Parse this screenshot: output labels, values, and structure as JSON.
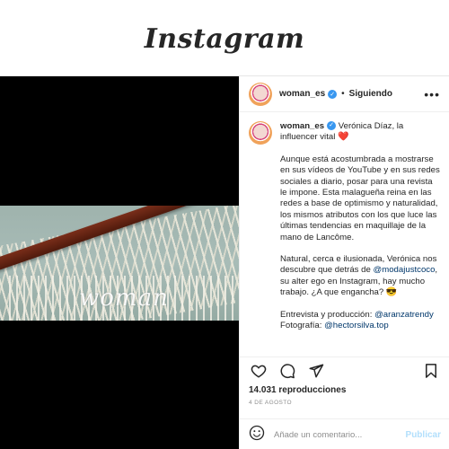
{
  "app": {
    "title": "Instagram"
  },
  "post": {
    "author": {
      "username": "woman_es",
      "verified": true,
      "follow_status": "Siguiendo",
      "separator": "•"
    },
    "media": {
      "watermark": "woman"
    },
    "caption": {
      "username": "woman_es",
      "headline": "Verónica Díaz, la influencer vital",
      "headline_emoji": "❤️",
      "paragraph_1": "Aunque está acostumbrada a mostrarse en sus vídeos de YouTube y en sus redes sociales a diario, posar para una revista le impone. Esta malagueña reina en las redes a base de optimismo y naturalidad, los mismos atributos con los que luce las últimas tendencias en maquillaje de la mano de Lancôme.",
      "paragraph_2_before": "Natural, cerca e ilusionada, Verónica nos descubre que detrás de ",
      "paragraph_2_link": "@modajustcoco",
      "paragraph_2_after": ", su alter ego en Instagram, hay mucho trabajo. ¿A que engancha? ",
      "paragraph_2_emoji": "😎",
      "credits_1_label": "Entrevista y producción: ",
      "credits_1_link": "@aranzatrendy",
      "credits_2_label": "Fotografía: ",
      "credits_2_link": "@hectorsilva.top"
    },
    "stats": {
      "views": "14.031 reproducciones",
      "date": "4 DE AGOSTO"
    },
    "comment": {
      "placeholder": "Añade un comentario...",
      "post_label": "Publicar"
    },
    "icons": {
      "more": "more-options-icon",
      "like": "heart-icon",
      "comment": "comment-icon",
      "share": "share-icon",
      "save": "bookmark-icon",
      "emoji": "smiley-icon"
    },
    "colors": {
      "verified": "#3897f0",
      "link": "#00376b",
      "post_button_disabled": "#b2dffc"
    }
  }
}
